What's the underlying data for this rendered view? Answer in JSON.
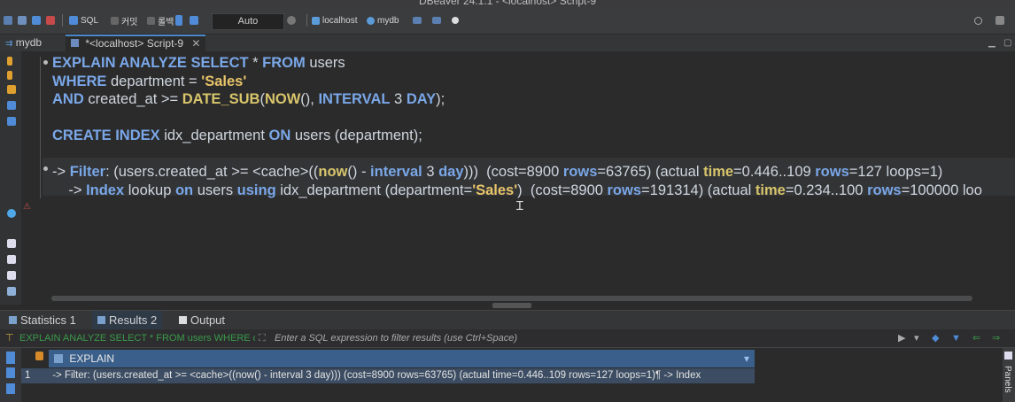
{
  "window": {
    "title": "DBeaver 24.1.1 - <localhost> Script-9"
  },
  "toolbar": {
    "sql_label": "SQL",
    "commit_label": "커밋",
    "rollback_label": "롤백",
    "transaction_mode": "Auto",
    "connection": "localhost",
    "database": "mydb"
  },
  "editor_tabs": [
    {
      "label": "mydb"
    },
    {
      "label": "*<localhost> Script-9"
    }
  ],
  "code": {
    "l1_kw": "EXPLAIN ANALYZE SELECT",
    "l1_rest": " * ",
    "l1_kw2": "FROM",
    "l1_tbl": " users",
    "l2_kw": "WHERE",
    "l2_col": " department = ",
    "l2_str": "'Sales'",
    "l3_kw": "AND",
    "l3_col": " created_at >= ",
    "l3_fn1": "DATE_SUB",
    "l3_p1": "(",
    "l3_fn2": "NOW",
    "l3_p2": "(), ",
    "l3_kw2": "INTERVAL",
    "l3_num": " 3 ",
    "l3_kw3": "DAY",
    "l3_end": ");",
    "l5_kw": "CREATE INDEX",
    "l5_name": " idx_department ",
    "l5_kw2": "ON",
    "l5_rest": " users (department);",
    "l7_a": "-> ",
    "l7_filter": "Filter",
    "l7_b": ": (users.created_at >= <cache>((",
    "l7_now": "now",
    "l7_c": "() - ",
    "l7_interval": "interval",
    "l7_d": " 3 ",
    "l7_day": "day",
    "l7_e": ")))  (cost=8900 ",
    "l7_rows": "rows",
    "l7_f": "=63765) (actual ",
    "l7_time": "time",
    "l7_g": "=0.446..109 ",
    "l7_rows2": "rows",
    "l7_h": "=127 loops=1)",
    "l8_a": "    -> ",
    "l8_index": "Index",
    "l8_b": " lookup ",
    "l8_on": "on",
    "l8_c": " users ",
    "l8_using": "using",
    "l8_d": " idx_department (department=",
    "l8_str": "'Sales'",
    "l8_e": ")  (cost=8900 ",
    "l8_rows": "rows",
    "l8_f": "=191314) (actual ",
    "l8_time": "time",
    "l8_g": "=0.234..100 ",
    "l8_rows2": "rows",
    "l8_h": "=100000 loo"
  },
  "result_tabs": [
    {
      "label": "Statistics 1"
    },
    {
      "label": "Results 2"
    },
    {
      "label": "Output"
    }
  ],
  "filter": {
    "query_text": "EXPLAIN ANALYZE SELECT * FROM users WHERE depa",
    "placeholder": "Enter a SQL expression to filter results (use Ctrl+Space)"
  },
  "grid": {
    "column_header": "EXPLAIN",
    "row_number": "1",
    "row_value": "-> Filter: (users.created_at >= <cache>((now() - interval 3 day)))  (cost=8900 rows=63765) (actual time=0.446..109 rows=127 loops=1)¶    -> Index"
  },
  "side_panel": {
    "label": "Panels"
  },
  "colors": {
    "keyword": "#7aa7e8",
    "function": "#d8c56c",
    "string": "#e8c46a",
    "accent": "#4a88c7"
  }
}
